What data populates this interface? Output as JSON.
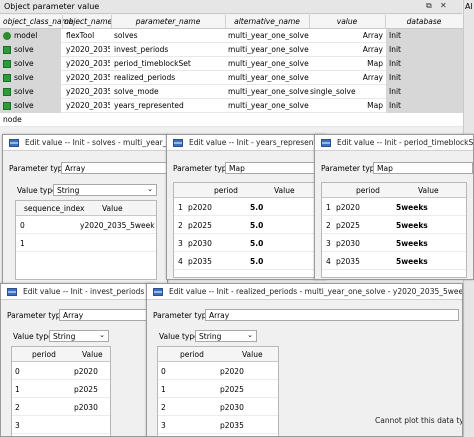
{
  "panel": {
    "title": "Object parameter value",
    "side_tab": "Al"
  },
  "table": {
    "headers": [
      "object_class_name",
      "object_name",
      "parameter_name",
      "alternative_name",
      "value",
      "database"
    ],
    "rows": [
      {
        "cls": "model",
        "obj": "flexTool",
        "param": "solves",
        "alt": "multi_year_one_solve",
        "value": "Array",
        "db": "Init"
      },
      {
        "cls": "solve",
        "obj": "y2020_2035...",
        "param": "invest_periods",
        "alt": "multi_year_one_solve",
        "value": "Array",
        "db": "Init"
      },
      {
        "cls": "solve",
        "obj": "y2020_2035...",
        "param": "period_timeblockSet",
        "alt": "multi_year_one_solve",
        "value": "Map",
        "db": "Init"
      },
      {
        "cls": "solve",
        "obj": "y2020_2035...",
        "param": "realized_periods",
        "alt": "multi_year_one_solve",
        "value": "Array",
        "db": "Init"
      },
      {
        "cls": "solve",
        "obj": "y2020_2035...",
        "param": "solve_mode",
        "alt": "multi_year_one_solve",
        "value": "single_solve",
        "db": "Init"
      },
      {
        "cls": "solve",
        "obj": "y2020_2035...",
        "param": "years_represented",
        "alt": "multi_year_one_solve",
        "value": "Map",
        "db": "Init"
      }
    ],
    "new_row": {
      "cls": "node",
      "obj": "",
      "param": "",
      "alt": "",
      "value": "",
      "db": ""
    }
  },
  "win1": {
    "title": "Edit value   -- Init - solves - multi_year_one_so...",
    "param_type_label": "Parameter type",
    "param_type": "Array",
    "value_type_label": "Value type:",
    "value_type": "String",
    "columns": [
      "sequence_index",
      "Value"
    ],
    "rows": [
      [
        "0",
        "y2020_2035_5week"
      ],
      [
        "1",
        ""
      ]
    ]
  },
  "win2": {
    "title": "Edit value   -- Init - years_represented - m",
    "param_type_label": "Parameter type",
    "param_type": "Map",
    "columns": [
      "period",
      "Value"
    ],
    "rows": [
      [
        "1",
        "p2020",
        "5.0"
      ],
      [
        "2",
        "p2025",
        "5.0"
      ],
      [
        "3",
        "p2030",
        "5.0"
      ],
      [
        "4",
        "p2035",
        "5.0"
      ]
    ]
  },
  "win3": {
    "title": "Edit value   -- Init - period_timeblockSet - m",
    "param_type_label": "Parameter type",
    "param_type": "Map",
    "columns": [
      "period",
      "Value"
    ],
    "rows": [
      [
        "1",
        "p2020",
        "5weeks"
      ],
      [
        "2",
        "p2025",
        "5weeks"
      ],
      [
        "3",
        "p2030",
        "5weeks"
      ],
      [
        "4",
        "p2035",
        "5weeks"
      ]
    ]
  },
  "win4": {
    "title": "Edit value   -- Init - invest_periods - multi...",
    "param_type_label": "Parameter type",
    "param_type": "Array",
    "value_type_label": "Value type:",
    "value_type": "String",
    "columns": [
      "period",
      "Value"
    ],
    "rows": [
      [
        "0",
        "p2020"
      ],
      [
        "1",
        "p2025"
      ],
      [
        "2",
        "p2030"
      ],
      [
        "3",
        ""
      ]
    ]
  },
  "win5": {
    "title": "Edit value   -- Init - realized_periods - multi_year_one_solve - y2020_2035_5week --",
    "param_type_label": "Parameter type",
    "param_type": "Array",
    "value_type_label": "Value type:",
    "value_type": "String",
    "columns": [
      "period",
      "Value"
    ],
    "rows": [
      [
        "0",
        "p2020"
      ],
      [
        "1",
        "p2025"
      ],
      [
        "2",
        "p2030"
      ],
      [
        "3",
        "p2035"
      ]
    ],
    "message": "Cannot plot this data type."
  },
  "colors": {
    "row_gray": "#d7d7d7",
    "solve_icon": "#2a9d3a",
    "window_icon": "#3a6fc4"
  }
}
